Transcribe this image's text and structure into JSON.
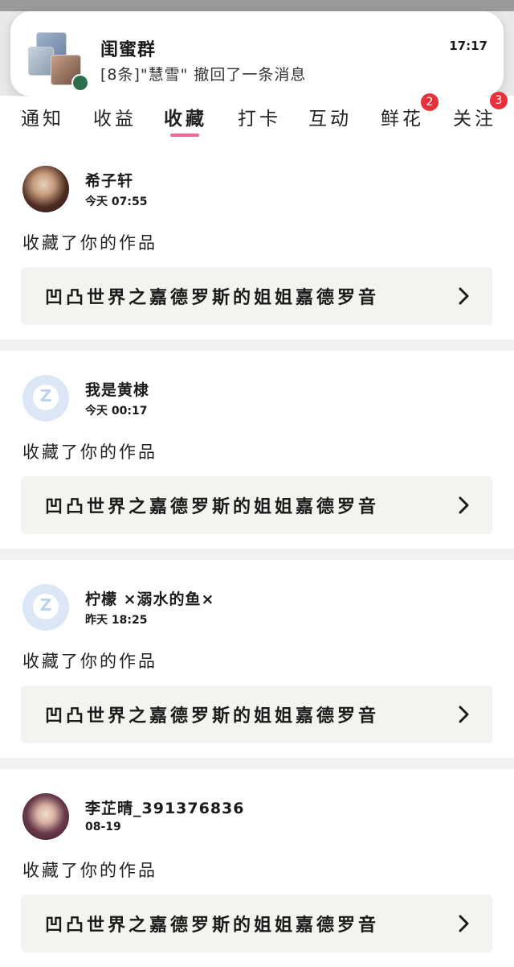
{
  "notification": {
    "title": "闺蜜群",
    "time": "17:17",
    "body": "[8条]\"慧雪\" 撤回了一条消息"
  },
  "tabs": [
    {
      "label": "通知",
      "active": false
    },
    {
      "label": "收益",
      "active": false
    },
    {
      "label": "收藏",
      "active": true
    },
    {
      "label": "打卡",
      "active": false
    },
    {
      "label": "互动",
      "active": false
    },
    {
      "label": "鲜花",
      "active": false,
      "badge": "2"
    },
    {
      "label": "关注",
      "active": false,
      "badge": "3"
    }
  ],
  "feed": [
    {
      "username": "希子轩",
      "time": "今天 07:55",
      "action": "收藏了你的作品",
      "work_title": "凹凸世界之嘉德罗斯的姐姐嘉德罗音",
      "avatar": "photo"
    },
    {
      "username": "我是黄棣",
      "time": "今天 00:17",
      "action": "收藏了你的作品",
      "work_title": "凹凸世界之嘉德罗斯的姐姐嘉德罗音",
      "avatar": "default"
    },
    {
      "username": "柠檬 ×溺水的鱼×",
      "time": "昨天 18:25",
      "action": "收藏了你的作品",
      "work_title": "凹凸世界之嘉德罗斯的姐姐嘉德罗音",
      "avatar": "default"
    },
    {
      "username": "李芷晴_391376836",
      "time": "08-19",
      "action": "收藏了你的作品",
      "work_title": "凹凸世界之嘉德罗斯的姐姐嘉德罗音",
      "avatar": "photo"
    }
  ],
  "colors": {
    "accent": "#f0679a",
    "badge": "#e8303a",
    "card_box": "#f3f3ef",
    "divider": "#f1f1f1"
  }
}
